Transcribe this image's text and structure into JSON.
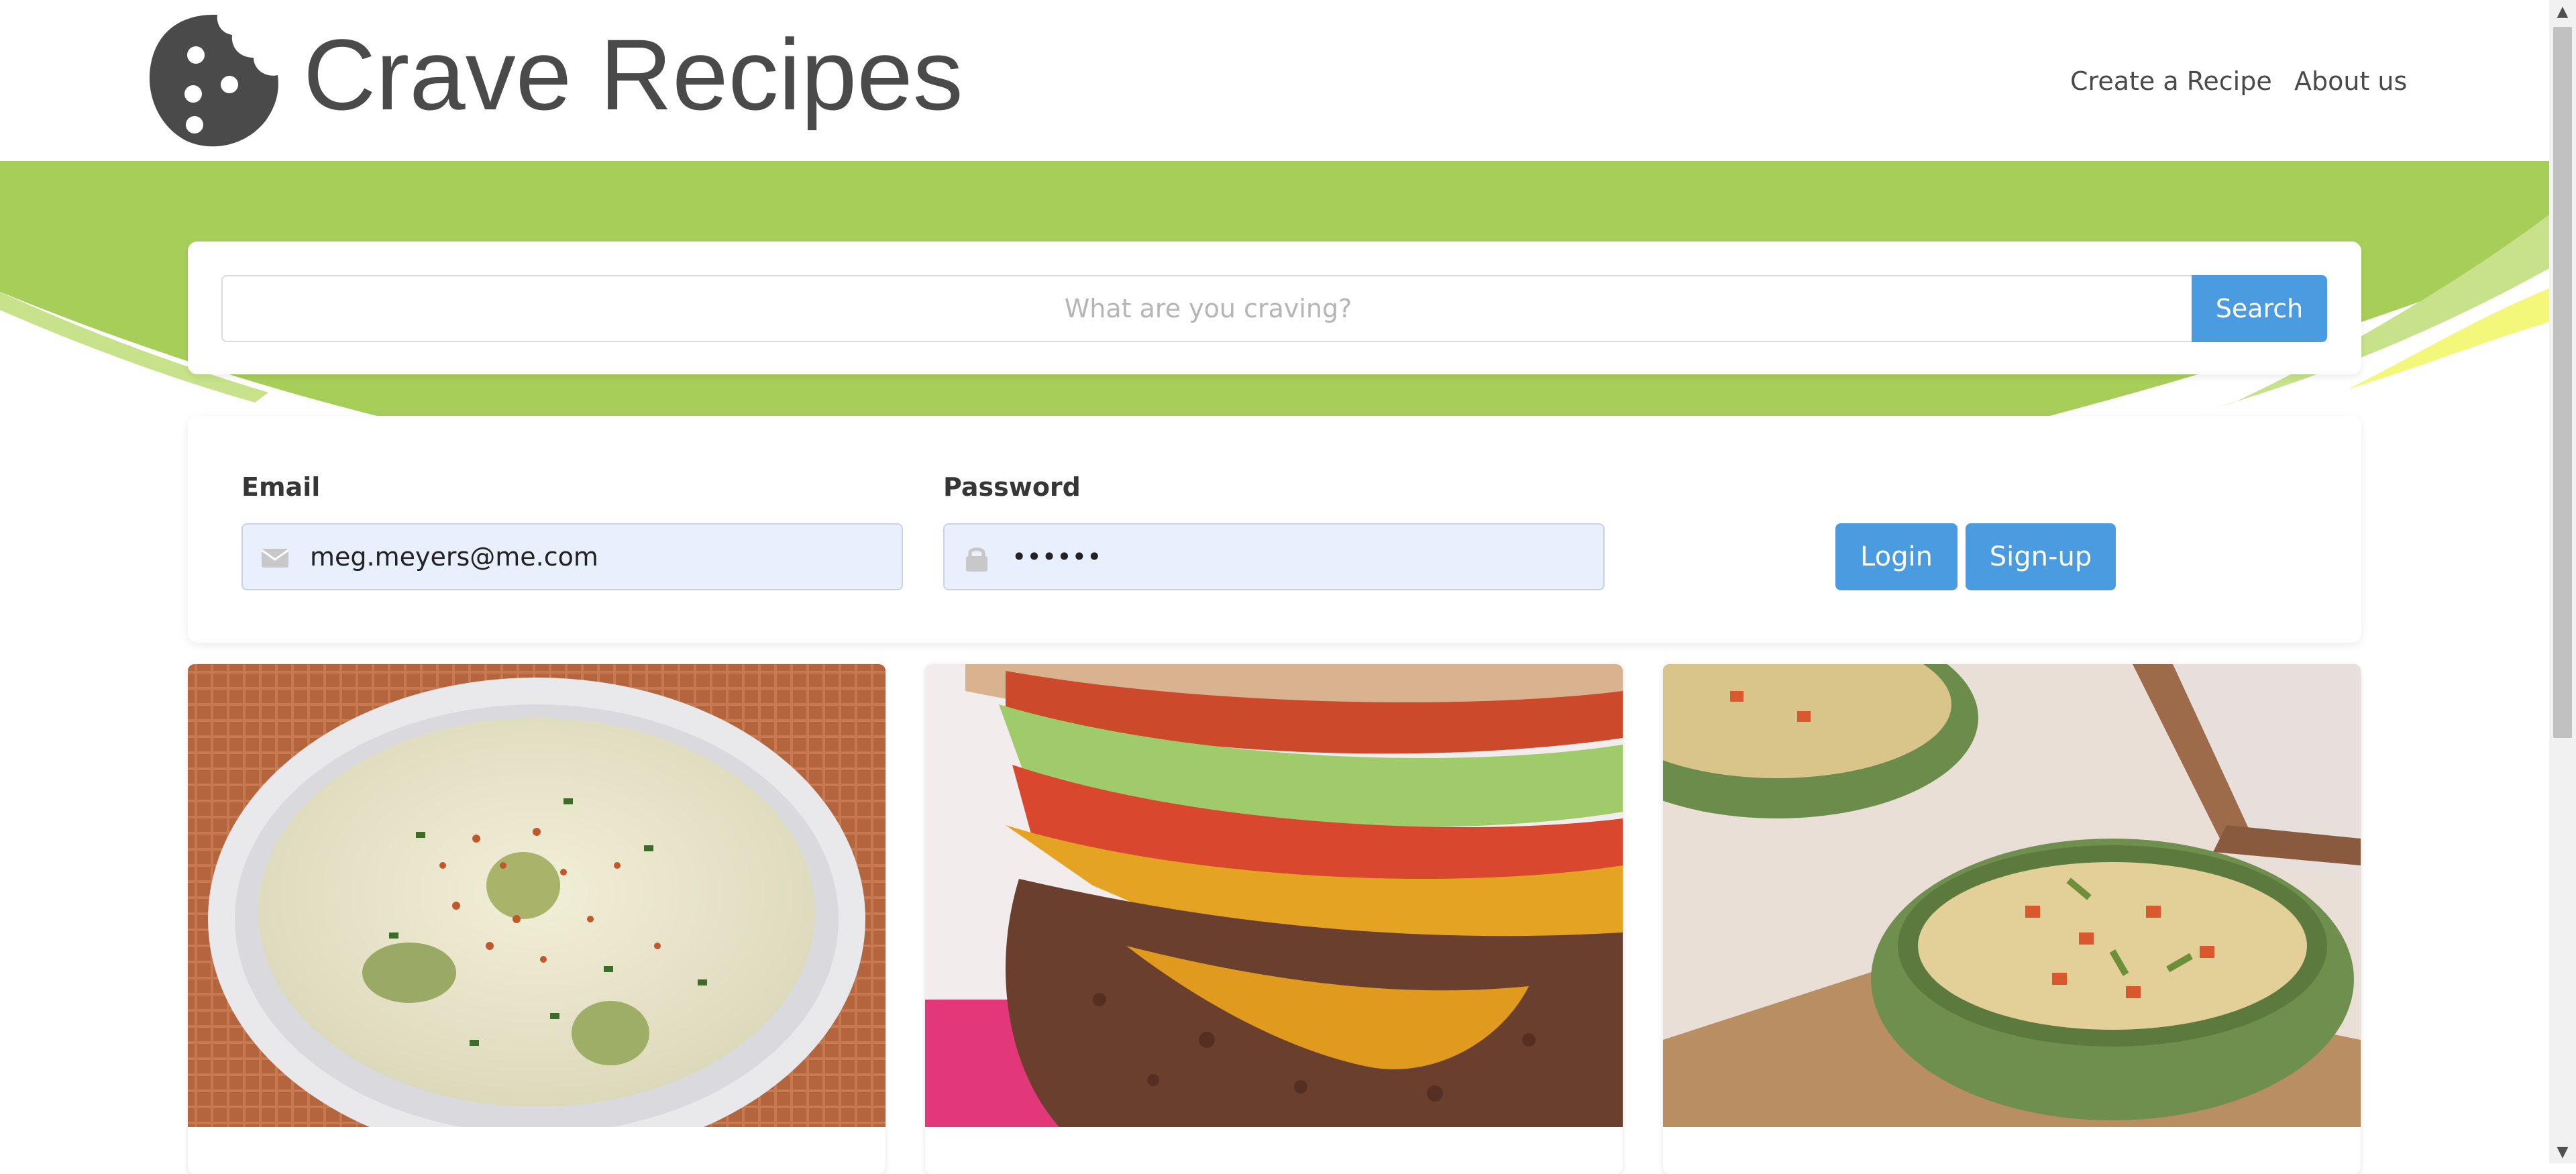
{
  "header": {
    "brand": "Crave Recipes",
    "nav": {
      "create": "Create a Recipe",
      "about": "About us"
    }
  },
  "search": {
    "placeholder": "What are you craving?",
    "value": "",
    "button": "Search"
  },
  "login": {
    "email_label": "Email",
    "email_value": "meg.meyers@me.com",
    "password_label": "Password",
    "password_value": "••••••",
    "login_button": "Login",
    "signup_button": "Sign-up"
  },
  "recipes": [
    {
      "image": "creamy-soup-with-chives-and-paprika"
    },
    {
      "image": "cheeseburger-closeup"
    },
    {
      "image": "vegetable-soup-in-green-bowls"
    }
  ],
  "colors": {
    "accent_blue": "#4a9be0",
    "hero_green": "#a8ce5a",
    "hero_light_green": "#c7e28a",
    "hero_yellow": "#f3f87a",
    "text_dark": "#4a4a4a"
  },
  "icons": {
    "logo": "cookie-icon",
    "email": "envelope-icon",
    "password": "lock-icon"
  }
}
